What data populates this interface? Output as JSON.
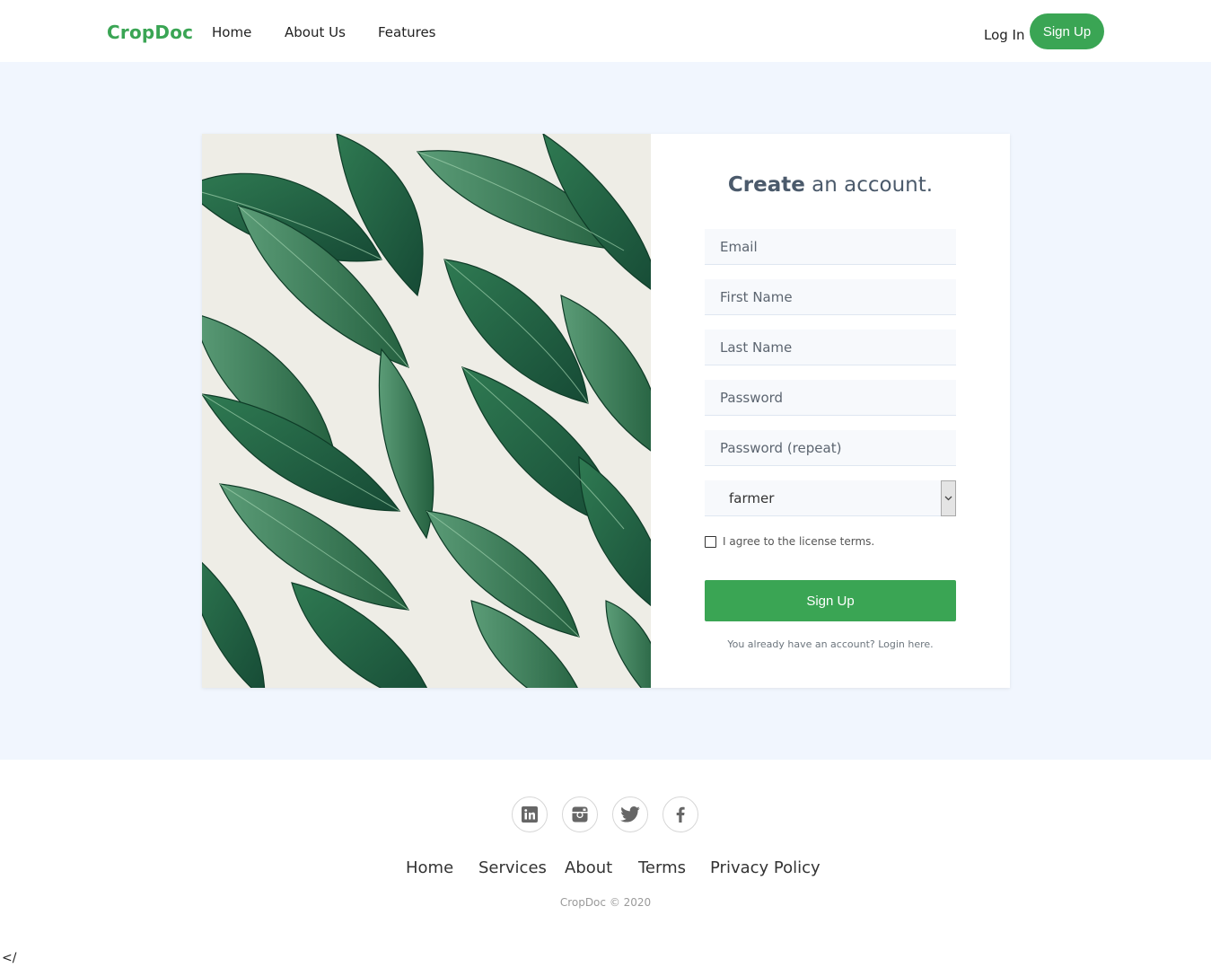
{
  "navbar": {
    "brand": "CropDoc",
    "links": [
      "Home",
      "About Us",
      "Features"
    ],
    "login": "Log In",
    "signup": "Sign Up"
  },
  "form": {
    "title_bold": "Create",
    "title_rest": " an account.",
    "email_placeholder": "Email",
    "first_name_placeholder": "First Name",
    "last_name_placeholder": "Last Name",
    "password_placeholder": "Password",
    "password_repeat_placeholder": "Password (repeat)",
    "role_selected": "farmer",
    "checkbox_label": "I agree to the license terms.",
    "submit": "Sign Up",
    "login_hint": "You already have an account? Login here."
  },
  "footer": {
    "social_icons": [
      "linkedin-icon",
      "instagram-icon",
      "twitter-icon",
      "facebook-icon"
    ],
    "links": [
      "Home",
      "Services",
      "About",
      "Terms",
      "Privacy Policy"
    ],
    "copyright": "CropDoc © 2020"
  },
  "stray_text": "</",
  "colors": {
    "accent": "#3aa554",
    "main_bg": "#f1f6fe",
    "title": "#4b5a6b"
  }
}
